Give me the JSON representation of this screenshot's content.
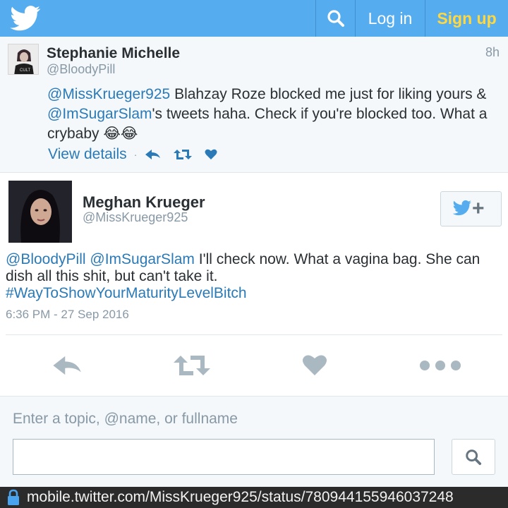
{
  "topbar": {
    "logo_icon": "twitter-bird-icon",
    "search_icon": "search-icon",
    "login_label": "Log in",
    "signup_label": "Sign up",
    "brand_color": "#55acee",
    "signup_color": "#ffd840"
  },
  "parent_tweet": {
    "name": "Stephanie Michelle",
    "handle": "@BloodyPill",
    "time": "8h",
    "avatar_text": "CULT",
    "text_parts": [
      {
        "text": "@MissKrueger925",
        "mention": true
      },
      {
        "text": " Blahzay Roze blocked me just for liking yours & ",
        "mention": false
      },
      {
        "text": "@ImSugarSlam",
        "mention": true
      },
      {
        "text": "'s tweets haha. Check if you're blocked too. What a crybaby ",
        "mention": false
      },
      {
        "text": "😂😂",
        "mention": false
      }
    ],
    "view_details": "View details",
    "separator": "·",
    "action_icons": [
      "reply-icon",
      "retweet-icon",
      "like-icon"
    ]
  },
  "main_tweet": {
    "name": "Meghan Krueger",
    "handle": "@MissKrueger925",
    "follow_icon": "follow-plus-icon",
    "follow_plus": "+",
    "mention1": "@BloodyPill",
    "mention2": "@ImSugarSlam",
    "body": " I'll check now. What a vagina bag. She can dish all this shit, but can't take it.",
    "hashtag": "#WayToShowYourMaturityLevelBitch",
    "timestamp": "6:36 PM - 27 Sep 2016",
    "action_icons": [
      "reply-icon",
      "retweet-icon",
      "like-icon",
      "more-icon"
    ]
  },
  "search": {
    "label": "Enter a topic, @name, or fullname",
    "value": "",
    "button_icon": "search-icon"
  },
  "urlbar": {
    "url": "mobile.twitter.com/MissKrueger925/status/780944155946037248",
    "lock_icon": "lock-icon"
  }
}
